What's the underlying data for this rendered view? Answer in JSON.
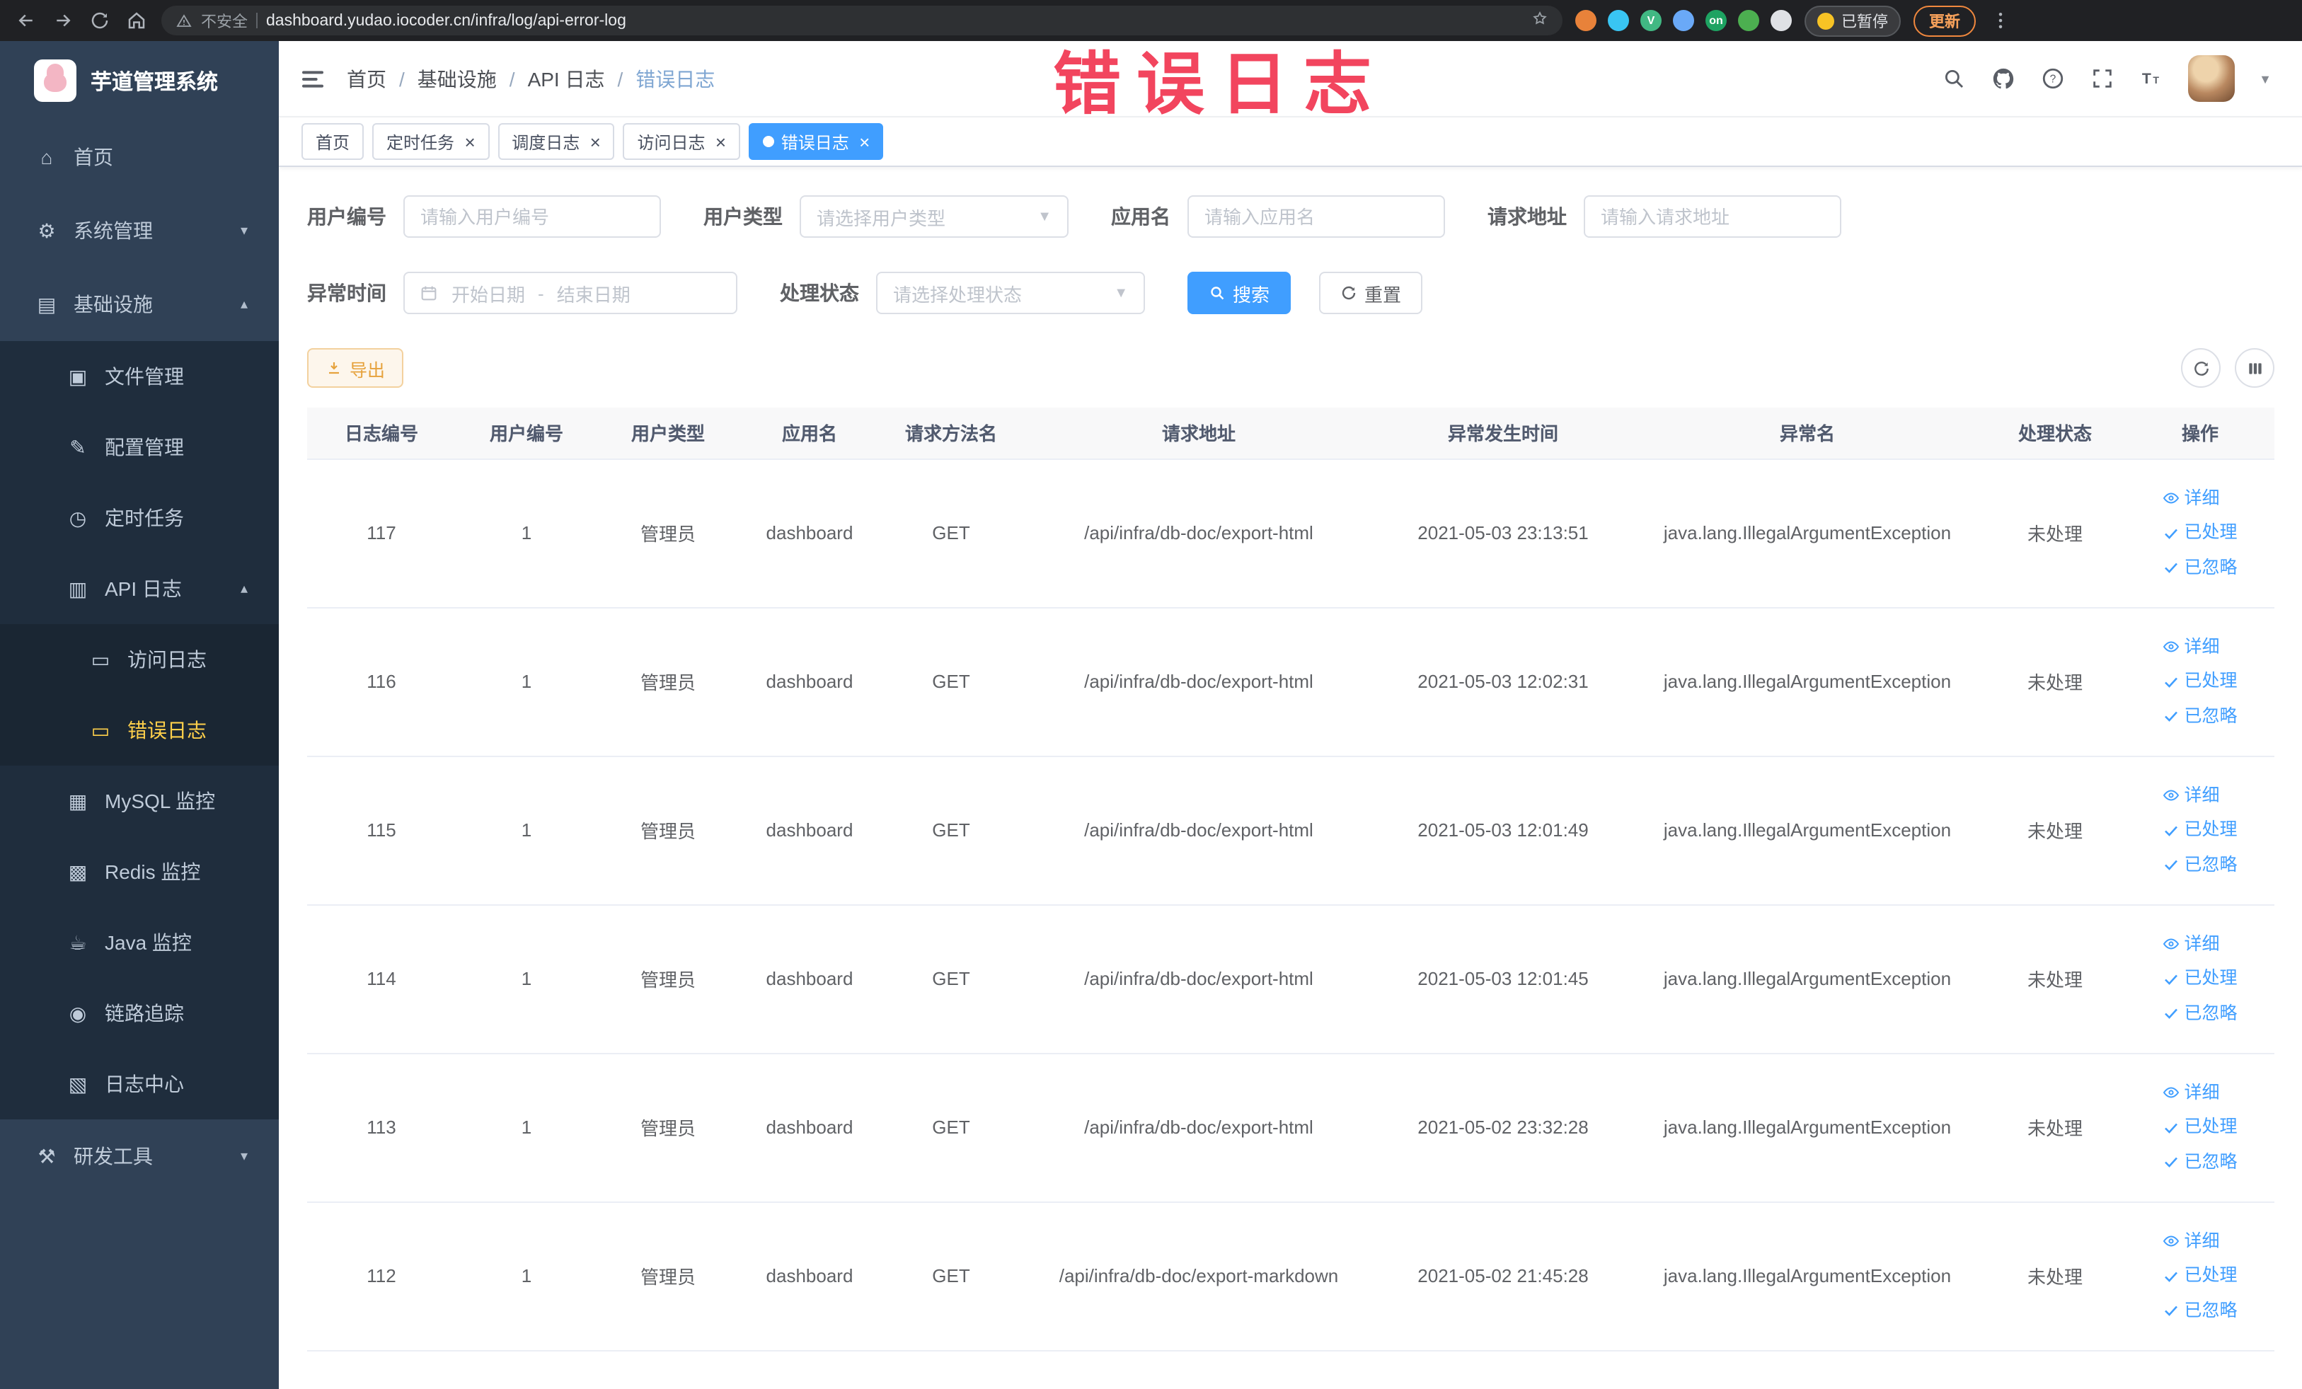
{
  "annotation": {
    "text": "错误日志"
  },
  "colors": {
    "primary": "#409eff",
    "sidebar_bg": "#304156",
    "submenu_bg": "#1f2d3d",
    "active_menu": "#ffd04b",
    "warning": "#e6a23c",
    "annotation_red": "#f2455e",
    "active_tag": "#409eff"
  },
  "browser": {
    "security_label": "不安全",
    "url": "dashboard.yudao.iocoder.cn/infra/log/api-error-log",
    "paused_badge": "已暂停",
    "update_button": "更新",
    "extensions": [
      {
        "name": "extension-orange",
        "color": "#e8823a",
        "text": ""
      },
      {
        "name": "extension-drop",
        "color": "#39c5f3",
        "text": ""
      },
      {
        "name": "extension-vue",
        "color": "#41b883",
        "text": "V"
      },
      {
        "name": "extension-grid",
        "color": "#6aa9f7",
        "text": ""
      },
      {
        "name": "extension-on-badge",
        "color": "#1ea362",
        "text": "on"
      },
      {
        "name": "extension-leaf",
        "color": "#4caf50",
        "text": ""
      },
      {
        "name": "extension-pin",
        "color": "#dfe1e5",
        "text": ""
      }
    ]
  },
  "sidebar": {
    "logo_title": "芋道管理系统",
    "items": [
      {
        "name": "sidebar-item-home",
        "icon_name": "home-icon",
        "glyph": "⌂",
        "label": "首页",
        "level": 1
      },
      {
        "name": "sidebar-item-system-mgmt",
        "icon_name": "gear-icon",
        "glyph": "⚙",
        "label": "系统管理",
        "level": 1,
        "chevron": "▾"
      },
      {
        "name": "sidebar-item-infrastructure",
        "icon_name": "infrastructure-icon",
        "glyph": "▤",
        "label": "基础设施",
        "level": 1,
        "chevron": "▴"
      },
      {
        "name": "sidebar-item-file-mgmt",
        "icon_name": "file-icon",
        "glyph": "▣",
        "label": "文件管理",
        "level": 2
      },
      {
        "name": "sidebar-item-config-mgmt",
        "icon_name": "edit-icon",
        "glyph": "✎",
        "label": "配置管理",
        "level": 2
      },
      {
        "name": "sidebar-item-scheduled-jobs",
        "icon_name": "clock-icon",
        "glyph": "◷",
        "label": "定时任务",
        "level": 2
      },
      {
        "name": "sidebar-item-api-logs",
        "icon_name": "log-icon",
        "glyph": "▥",
        "label": "API 日志",
        "level": 2,
        "chevron": "▴"
      },
      {
        "name": "sidebar-item-access-log",
        "icon_name": "document-icon",
        "glyph": "▭",
        "label": "访问日志",
        "level": 3
      },
      {
        "name": "sidebar-item-error-log",
        "icon_name": "document-icon",
        "glyph": "▭",
        "label": "错误日志",
        "level": 3,
        "active": true
      },
      {
        "name": "sidebar-item-mysql-monitor",
        "icon_name": "database-icon",
        "glyph": "▦",
        "label": "MySQL 监控",
        "level": 2
      },
      {
        "name": "sidebar-item-redis-monitor",
        "icon_name": "database-icon",
        "glyph": "▩",
        "label": "Redis 监控",
        "level": 2
      },
      {
        "name": "sidebar-item-java-monitor",
        "icon_name": "coffee-icon",
        "glyph": "☕",
        "label": "Java 监控",
        "level": 2
      },
      {
        "name": "sidebar-item-trace",
        "icon_name": "eye-icon",
        "glyph": "◉",
        "label": "链路追踪",
        "level": 2
      },
      {
        "name": "sidebar-item-log-center",
        "icon_name": "log-icon",
        "glyph": "▧",
        "label": "日志中心",
        "level": 2
      },
      {
        "name": "sidebar-item-dev-tools",
        "icon_name": "tools-icon",
        "glyph": "⚒",
        "label": "研发工具",
        "level": 1,
        "chevron": "▾"
      }
    ]
  },
  "breadcrumb": {
    "separator": "/",
    "items": [
      {
        "label": "首页"
      },
      {
        "label": "基础设施"
      },
      {
        "label": "API 日志"
      },
      {
        "label": "错误日志",
        "last": true
      }
    ]
  },
  "tags": [
    {
      "name": "tag-home",
      "label": "首页"
    },
    {
      "name": "tag-scheduled-jobs",
      "label": "定时任务",
      "closable": true
    },
    {
      "name": "tag-schedule-log",
      "label": "调度日志",
      "closable": true
    },
    {
      "name": "tag-access-log",
      "label": "访问日志",
      "closable": true
    },
    {
      "name": "tag-error-log",
      "label": "错误日志",
      "closable": true,
      "active": true
    }
  ],
  "filters": {
    "user_id_label": "用户编号",
    "user_id_placeholder": "请输入用户编号",
    "user_type_label": "用户类型",
    "user_type_placeholder": "请选择用户类型",
    "app_label": "应用名",
    "app_placeholder": "请输入应用名",
    "url_label": "请求地址",
    "url_placeholder": "请输入请求地址",
    "time_label": "异常时间",
    "date_start_placeholder": "开始日期",
    "date_separator": "-",
    "date_end_placeholder": "结束日期",
    "status_label": "处理状态",
    "status_placeholder": "请选择处理状态",
    "search_label": "搜索",
    "reset_label": "重置"
  },
  "toolbar": {
    "export_label": "导出"
  },
  "table": {
    "columns": [
      {
        "label": "日志编号"
      },
      {
        "label": "用户编号"
      },
      {
        "label": "用户类型"
      },
      {
        "label": "应用名"
      },
      {
        "label": "请求方法名"
      },
      {
        "label": "请求地址"
      },
      {
        "label": "异常发生时间"
      },
      {
        "label": "异常名"
      },
      {
        "label": "处理状态"
      },
      {
        "label": "操作"
      }
    ],
    "actions": {
      "detail": "详细",
      "processed": "已处理",
      "ignored": "已忽略"
    },
    "rows": [
      {
        "id": "117",
        "user_id": "1",
        "user_type": "管理员",
        "app": "dashboard",
        "method": "GET",
        "url": "/api/infra/db-doc/export-html",
        "time": "2021-05-03 23:13:51",
        "exception": "java.lang.IllegalArgumentException",
        "status": "未处理"
      },
      {
        "id": "116",
        "user_id": "1",
        "user_type": "管理员",
        "app": "dashboard",
        "method": "GET",
        "url": "/api/infra/db-doc/export-html",
        "time": "2021-05-03 12:02:31",
        "exception": "java.lang.IllegalArgumentException",
        "status": "未处理"
      },
      {
        "id": "115",
        "user_id": "1",
        "user_type": "管理员",
        "app": "dashboard",
        "method": "GET",
        "url": "/api/infra/db-doc/export-html",
        "time": "2021-05-03 12:01:49",
        "exception": "java.lang.IllegalArgumentException",
        "status": "未处理"
      },
      {
        "id": "114",
        "user_id": "1",
        "user_type": "管理员",
        "app": "dashboard",
        "method": "GET",
        "url": "/api/infra/db-doc/export-html",
        "time": "2021-05-03 12:01:45",
        "exception": "java.lang.IllegalArgumentException",
        "status": "未处理"
      },
      {
        "id": "113",
        "user_id": "1",
        "user_type": "管理员",
        "app": "dashboard",
        "method": "GET",
        "url": "/api/infra/db-doc/export-html",
        "time": "2021-05-02 23:32:28",
        "exception": "java.lang.IllegalArgumentException",
        "status": "未处理"
      },
      {
        "id": "112",
        "user_id": "1",
        "user_type": "管理员",
        "app": "dashboard",
        "method": "GET",
        "url": "/api/infra/db-doc/export-markdown",
        "time": "2021-05-02 21:45:28",
        "exception": "java.lang.IllegalArgumentException",
        "status": "未处理"
      }
    ]
  }
}
